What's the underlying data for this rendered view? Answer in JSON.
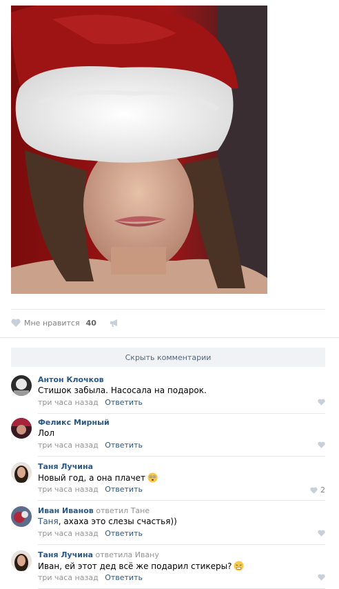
{
  "post": {
    "likes_label": "Мне нравится",
    "likes_count": "40"
  },
  "comments_toggle": "Скрыть комментарии",
  "comments": [
    {
      "author": "Антон Клочков",
      "reply_to": "",
      "mention": "",
      "text": "Стишок забыла. Насосала на подарок.",
      "time": "три часа назад",
      "reply": "Ответить",
      "likes": ""
    },
    {
      "author": "Феликс Мирный",
      "reply_to": "",
      "mention": "",
      "text": "Лол",
      "time": "три часа назад",
      "reply": "Ответить",
      "likes": ""
    },
    {
      "author": "Таня Лучина",
      "reply_to": "",
      "mention": "",
      "text": "Новый год, а она плачет",
      "time": "три часа назад",
      "reply": "Ответить",
      "likes": "2"
    },
    {
      "author": "Иван Иванов",
      "reply_to": "ответил Тане",
      "mention": "Таня",
      "text": ", ахаха это слезы счастья))",
      "time": "три часа назад",
      "reply": "Ответить",
      "likes": ""
    },
    {
      "author": "Таня Лучина",
      "reply_to": "ответила Ивану",
      "mention": "",
      "text": "Иван, ей этот дед всё же подарил стикеры?",
      "time": "три часа назад",
      "reply": "Ответить",
      "likes": ""
    }
  ],
  "colors": {
    "link": "#2a5885",
    "muted": "#939393",
    "heart": "#c5d0db",
    "hat_red": "#9e1414"
  },
  "icons": [
    "heart-icon",
    "megaphone-icon",
    "emoji-icon"
  ]
}
